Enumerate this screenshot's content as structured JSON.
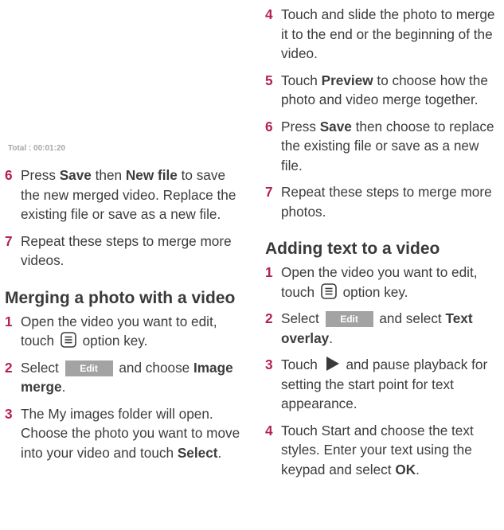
{
  "total_label": "Total : 00:01:20",
  "left": {
    "steps": [
      {
        "num": "6",
        "parts": [
          "Press ",
          "Save",
          " then ",
          "New file",
          " to save the new merged video. Replace the existing file or save as a new file."
        ]
      },
      {
        "num": "7",
        "text": "Repeat these steps to merge more videos."
      }
    ],
    "heading": "Merging a photo with a video",
    "steps2": [
      {
        "num": "1",
        "text_before": "Open the video you want to edit, touch",
        "text_after": "option key."
      },
      {
        "num": "2",
        "text_before": "Select",
        "button": "Edit",
        "text_mid": "and choose",
        "bold": "Image merge",
        "text_after": "."
      },
      {
        "num": "3",
        "text": "The My images folder will open. Choose the photo you want to move into your video and touch",
        "bold": "Select",
        "text_after": "."
      }
    ]
  },
  "right": {
    "steps": [
      {
        "num": "4",
        "text": "Touch and slide the photo to merge it to the end or the beginning of the video."
      },
      {
        "num": "5",
        "before": "Touch",
        "bold": "Preview",
        "after": "to choose how the photo and video merge together."
      },
      {
        "num": "6",
        "before": "Press",
        "bold": "Save",
        "after": "then choose to replace the existing file or save as a new file."
      },
      {
        "num": "7",
        "text": "Repeat these steps to merge more photos."
      }
    ],
    "heading": "Adding text to a video",
    "steps2": [
      {
        "num": "1",
        "text_before": "Open the video you want to edit, touch",
        "text_after": "option key."
      },
      {
        "num": "2",
        "text_before": "Select",
        "button": "Edit",
        "text_mid": "and select",
        "bold": "Text overlay",
        "text_after": "."
      },
      {
        "num": "3",
        "before": "Touch",
        "after": "and pause playback for setting the start point for text appearance."
      },
      {
        "num": "4",
        "text": "Touch Start and choose the text styles. Enter your text using the keypad and select",
        "bold": "OK",
        "text_after": "."
      }
    ]
  },
  "colors": {
    "accent": "#b5214d",
    "button": "#a3a3a3",
    "text": "#3c3c3c"
  }
}
